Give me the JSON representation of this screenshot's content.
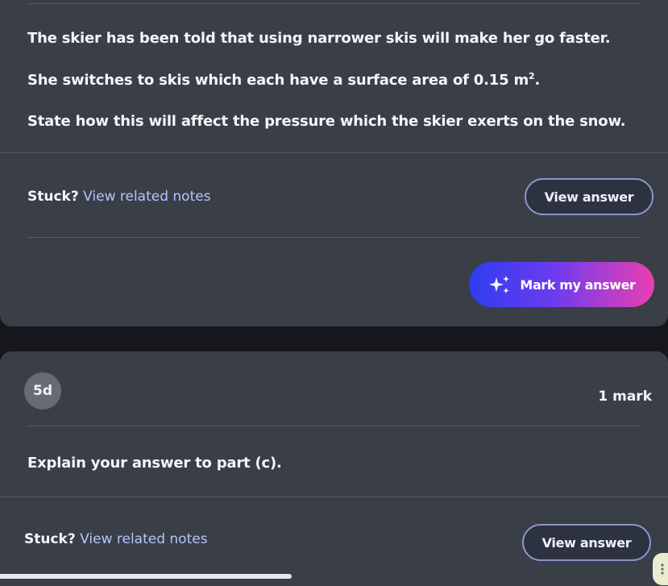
{
  "question": {
    "line1": "The skier has been told that using narrower skis will make her go faster.",
    "line2_prefix": "She switches to skis which each have a surface area of 0.15 m",
    "line2_sup": "2",
    "line2_suffix": ".",
    "line3": "State how this will affect the pressure which the skier exerts on the snow."
  },
  "help_a": {
    "stuck_label": "Stuck?",
    "notes_link": "View related notes",
    "view_answer_label": "View answer"
  },
  "mark_button": {
    "label": "Mark my answer",
    "icon": "sparkle-icon"
  },
  "part_d": {
    "badge": "5d",
    "marks": "1 mark",
    "prompt": "Explain your answer to part (c)."
  },
  "help_b": {
    "stuck_label": "Stuck?",
    "notes_link": "View related notes",
    "view_answer_label": "View answer"
  },
  "colors": {
    "background": "#15171d",
    "card": "#3a3e47",
    "link": "#b7c3ff",
    "gradient_start": "#2f3cf0",
    "gradient_end": "#e93fb0"
  }
}
